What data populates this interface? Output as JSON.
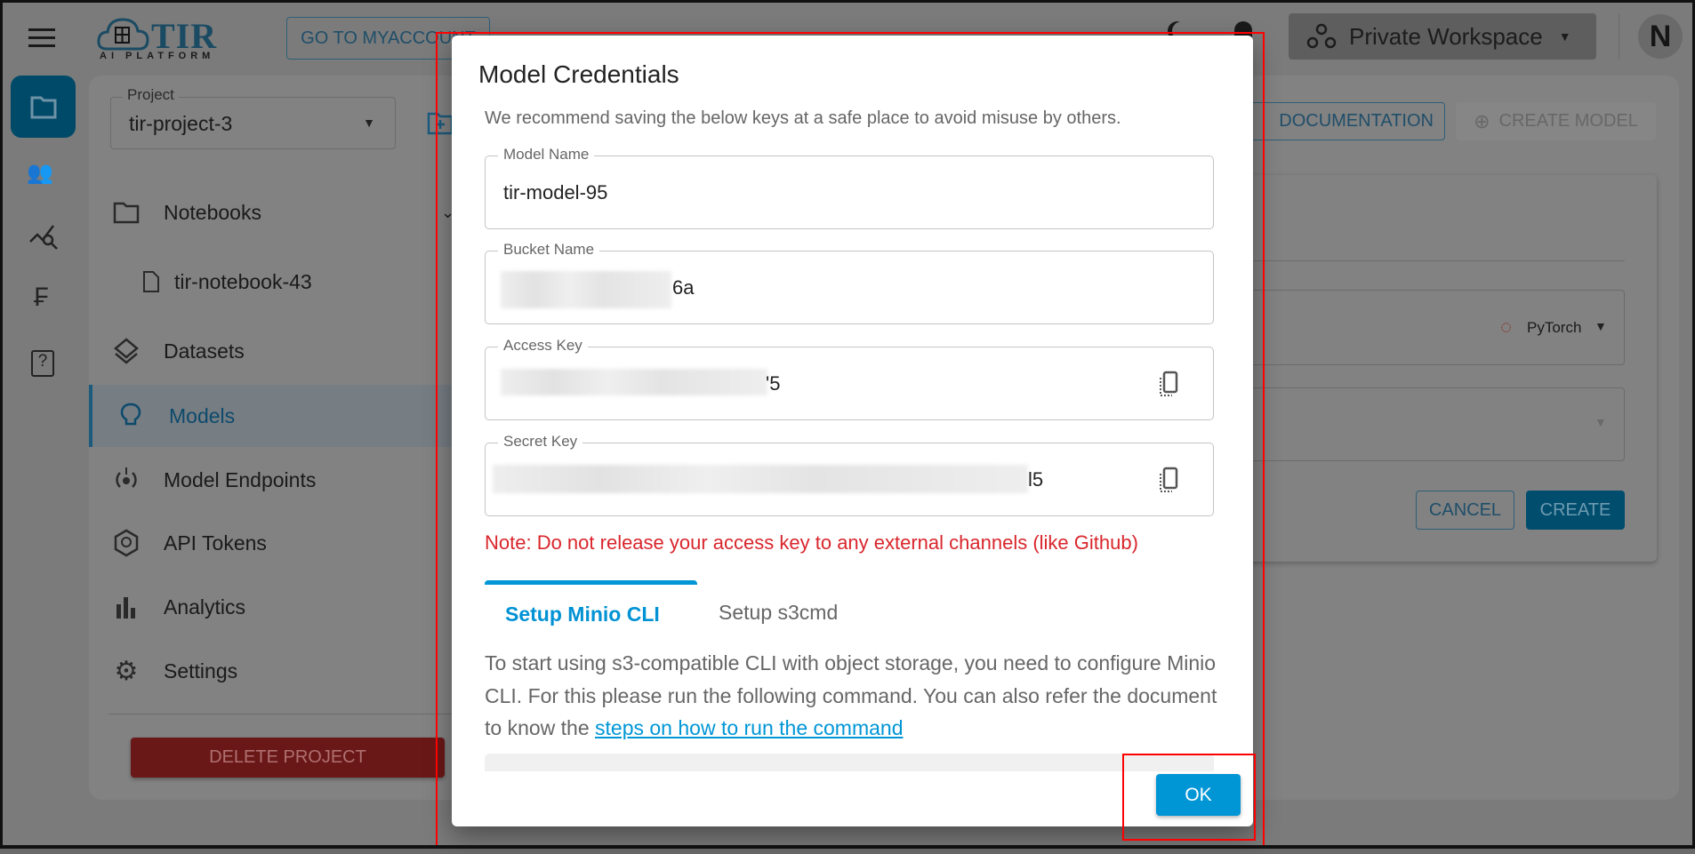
{
  "header": {
    "logo_text": "TIR",
    "logo_subtitle": "AI PLATFORM",
    "go_to_account": "GO TO MYACCOUNT",
    "workspace": "Private Workspace",
    "avatar_initial": "N"
  },
  "project": {
    "label": "Project",
    "value": "tir-project-3"
  },
  "sidebar": {
    "items": [
      {
        "label": "Notebooks",
        "icon": "folder-icon"
      },
      {
        "label": "tir-notebook-43",
        "icon": "file-icon"
      },
      {
        "label": "Datasets",
        "icon": "layers-icon"
      },
      {
        "label": "Models",
        "icon": "lightbulb-icon",
        "active": true
      },
      {
        "label": "Model Endpoints",
        "icon": "endpoint-icon"
      },
      {
        "label": "API Tokens",
        "icon": "token-icon"
      },
      {
        "label": "Analytics",
        "icon": "bar-chart-icon"
      },
      {
        "label": "Settings",
        "icon": "gear-icon"
      }
    ],
    "delete_project": "DELETE PROJECT"
  },
  "toolbar": {
    "documentation": "DOCUMENTATION",
    "create_model": "CREATE MODEL"
  },
  "form_card": {
    "framework": "PyTorch",
    "cancel": "CANCEL",
    "create": "CREATE"
  },
  "dialog": {
    "title": "Model Credentials",
    "subtitle": "We recommend saving the below keys at a safe place to avoid misuse by others.",
    "fields": [
      {
        "label": "Model Name",
        "value": "tir-model-95"
      },
      {
        "label": "Bucket Name",
        "value": "6a"
      },
      {
        "label": "Access Key",
        "value": "'5"
      },
      {
        "label": "Secret Key",
        "value": "l5"
      }
    ],
    "note": "Note: Do not release your access key to any external channels (like Github)",
    "tabs": [
      "Setup Minio CLI",
      "Setup s3cmd"
    ],
    "paragraph": "To start using s3-compatible CLI with object storage, you need to configure Minio CLI. For this please run the following command. You can also refer the document to know the ",
    "link": "steps on how to run the command",
    "ok": "OK"
  },
  "colors": {
    "accent": "#0096d6",
    "note_red": "#d9262c",
    "highlight": "#ff0000"
  }
}
